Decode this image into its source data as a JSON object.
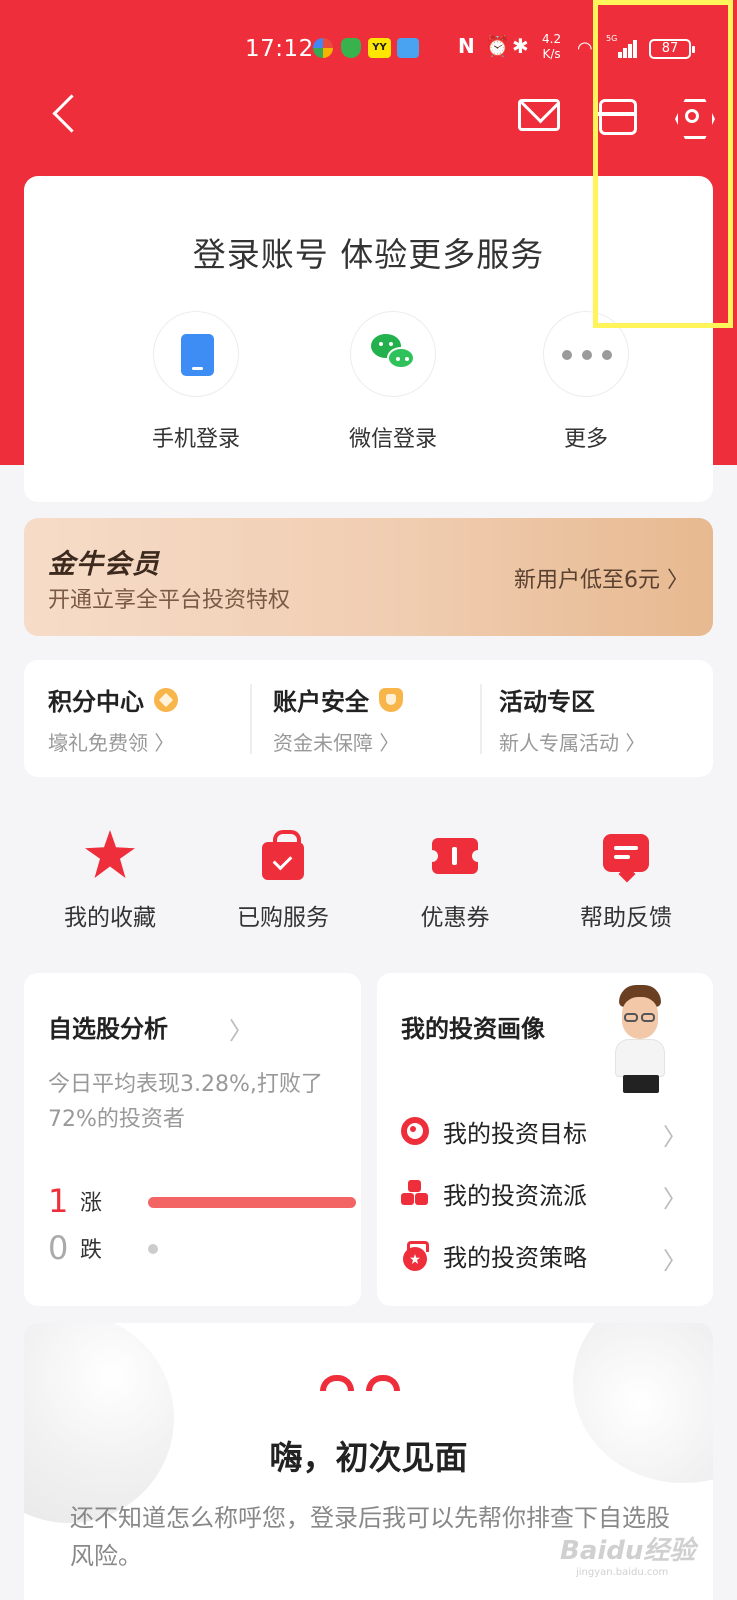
{
  "status_bar": {
    "time": "17:12",
    "speed_value": "4.2",
    "speed_unit": "K/s",
    "network": "5G",
    "battery": "87"
  },
  "nav": {
    "back_icon": "back-arrow-icon",
    "mail_icon": "mail-icon",
    "scan_icon": "scan-icon",
    "settings_icon": "settings-icon"
  },
  "login": {
    "title": "登录账号 体验更多服务",
    "options": [
      {
        "label": "手机登录",
        "icon": "phone-icon"
      },
      {
        "label": "微信登录",
        "icon": "wechat-icon"
      },
      {
        "label": "更多",
        "icon": "more-dots-icon"
      }
    ]
  },
  "vip": {
    "title": "金牛会员",
    "subtitle": "开通立享全平台投资特权",
    "cta": "新用户低至6元 〉"
  },
  "quick_links": [
    {
      "title": "积分中心",
      "sub": "壕礼免费领 〉"
    },
    {
      "title": "账户安全",
      "sub": "资金未保障 〉"
    },
    {
      "title": "活动专区",
      "sub": "新人专属活动 〉"
    }
  ],
  "services": [
    {
      "label": "我的收藏",
      "icon": "star-icon"
    },
    {
      "label": "已购服务",
      "icon": "shopping-bag-icon"
    },
    {
      "label": "优惠券",
      "icon": "coupon-icon"
    },
    {
      "label": "帮助反馈",
      "icon": "feedback-icon"
    }
  ],
  "analysis": {
    "title": "自选股分析",
    "chevron": "〉",
    "description": "今日平均表现3.28%,打败了72%的投资者",
    "up_count": "1",
    "up_label": "涨",
    "down_count": "0",
    "down_label": "跌",
    "up_fraction": 1.0
  },
  "profile": {
    "title": "我的投资画像",
    "items": [
      {
        "label": "我的投资目标",
        "icon": "target-icon"
      },
      {
        "label": "我的投资流派",
        "icon": "cubes-icon"
      },
      {
        "label": "我的投资策略",
        "icon": "medal-icon"
      }
    ],
    "chevron": "〉"
  },
  "greeting": {
    "title": "嗨，初次见面",
    "description": "还不知道怎么称呼您，登录后我可以先帮你排查下自选股风险。"
  },
  "watermark": {
    "text": "Baidu经验",
    "sub": "jingyan.baidu.com"
  },
  "colors": {
    "brand_red": "#ee2f3b",
    "highlight_yellow": "#fff45a",
    "vip_gold": "#e7b990"
  }
}
